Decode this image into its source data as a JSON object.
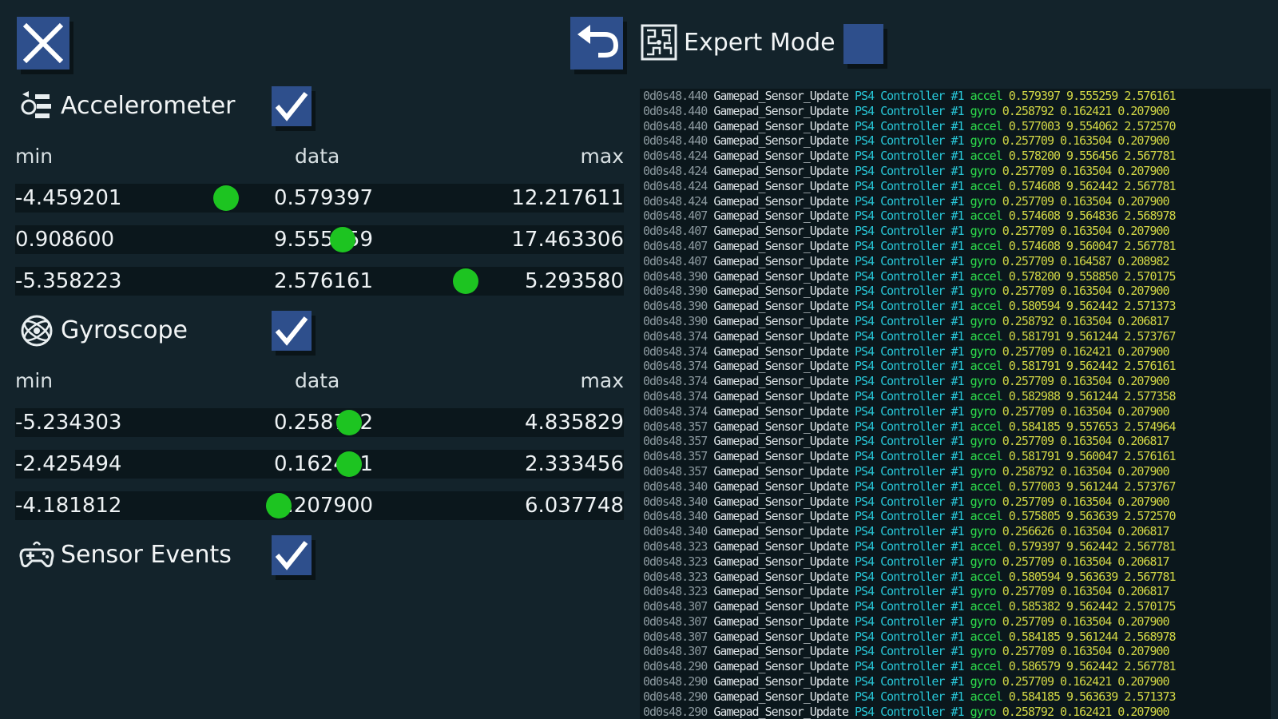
{
  "header": {
    "expert_mode_label": "Expert Mode"
  },
  "sections": {
    "accelerometer": {
      "title": "Accelerometer",
      "checked": true,
      "col_min": "min",
      "col_data": "data",
      "col_max": "max",
      "rows": [
        {
          "min": "-4.459201",
          "data": "0.579397",
          "max": "12.217611",
          "level": 0.34
        },
        {
          "min": "0.908600",
          "data": "9.555259",
          "max": "17.463306",
          "level": 0.54
        },
        {
          "min": "-5.358223",
          "data": "2.576161",
          "max": "5.293580",
          "level": 0.75
        }
      ]
    },
    "gyroscope": {
      "title": "Gyroscope",
      "checked": true,
      "col_min": "min",
      "col_data": "data",
      "col_max": "max",
      "rows": [
        {
          "min": "-5.234303",
          "data": "0.258792",
          "max": "4.835829",
          "level": 0.55
        },
        {
          "min": "-2.425494",
          "data": "0.162421",
          "max": "2.333456",
          "level": 0.55
        },
        {
          "min": "-4.181812",
          "data": "0.207900",
          "max": "6.037748",
          "level": 0.43
        }
      ]
    },
    "sensor_events": {
      "title": "Sensor Events",
      "checked": true
    }
  },
  "log": {
    "lines": [
      {
        "time": "0d0s48.440",
        "func": "Gamepad_Sensor_Update",
        "device": "PS4 Controller #1",
        "type": "accel",
        "values": "0.579397 9.555259 2.576161"
      },
      {
        "time": "0d0s48.440",
        "func": "Gamepad_Sensor_Update",
        "device": "PS4 Controller #1",
        "type": "gyro",
        "values": "0.258792 0.162421 0.207900"
      },
      {
        "time": "0d0s48.440",
        "func": "Gamepad_Sensor_Update",
        "device": "PS4 Controller #1",
        "type": "accel",
        "values": "0.577003 9.554062 2.572570"
      },
      {
        "time": "0d0s48.440",
        "func": "Gamepad_Sensor_Update",
        "device": "PS4 Controller #1",
        "type": "gyro",
        "values": "0.257709 0.163504 0.207900"
      },
      {
        "time": "0d0s48.424",
        "func": "Gamepad_Sensor_Update",
        "device": "PS4 Controller #1",
        "type": "accel",
        "values": "0.578200 9.556456 2.567781"
      },
      {
        "time": "0d0s48.424",
        "func": "Gamepad_Sensor_Update",
        "device": "PS4 Controller #1",
        "type": "gyro",
        "values": "0.257709 0.163504 0.207900"
      },
      {
        "time": "0d0s48.424",
        "func": "Gamepad_Sensor_Update",
        "device": "PS4 Controller #1",
        "type": "accel",
        "values": "0.574608 9.562442 2.567781"
      },
      {
        "time": "0d0s48.424",
        "func": "Gamepad_Sensor_Update",
        "device": "PS4 Controller #1",
        "type": "gyro",
        "values": "0.257709 0.163504 0.207900"
      },
      {
        "time": "0d0s48.407",
        "func": "Gamepad_Sensor_Update",
        "device": "PS4 Controller #1",
        "type": "accel",
        "values": "0.574608 9.564836 2.568978"
      },
      {
        "time": "0d0s48.407",
        "func": "Gamepad_Sensor_Update",
        "device": "PS4 Controller #1",
        "type": "gyro",
        "values": "0.257709 0.163504 0.207900"
      },
      {
        "time": "0d0s48.407",
        "func": "Gamepad_Sensor_Update",
        "device": "PS4 Controller #1",
        "type": "accel",
        "values": "0.574608 9.560047 2.567781"
      },
      {
        "time": "0d0s48.407",
        "func": "Gamepad_Sensor_Update",
        "device": "PS4 Controller #1",
        "type": "gyro",
        "values": "0.257709 0.164587 0.208982"
      },
      {
        "time": "0d0s48.390",
        "func": "Gamepad_Sensor_Update",
        "device": "PS4 Controller #1",
        "type": "accel",
        "values": "0.578200 9.558850 2.570175"
      },
      {
        "time": "0d0s48.390",
        "func": "Gamepad_Sensor_Update",
        "device": "PS4 Controller #1",
        "type": "gyro",
        "values": "0.257709 0.163504 0.207900"
      },
      {
        "time": "0d0s48.390",
        "func": "Gamepad_Sensor_Update",
        "device": "PS4 Controller #1",
        "type": "accel",
        "values": "0.580594 9.562442 2.571373"
      },
      {
        "time": "0d0s48.390",
        "func": "Gamepad_Sensor_Update",
        "device": "PS4 Controller #1",
        "type": "gyro",
        "values": "0.258792 0.163504 0.206817"
      },
      {
        "time": "0d0s48.374",
        "func": "Gamepad_Sensor_Update",
        "device": "PS4 Controller #1",
        "type": "accel",
        "values": "0.581791 9.561244 2.573767"
      },
      {
        "time": "0d0s48.374",
        "func": "Gamepad_Sensor_Update",
        "device": "PS4 Controller #1",
        "type": "gyro",
        "values": "0.257709 0.162421 0.207900"
      },
      {
        "time": "0d0s48.374",
        "func": "Gamepad_Sensor_Update",
        "device": "PS4 Controller #1",
        "type": "accel",
        "values": "0.581791 9.562442 2.576161"
      },
      {
        "time": "0d0s48.374",
        "func": "Gamepad_Sensor_Update",
        "device": "PS4 Controller #1",
        "type": "gyro",
        "values": "0.257709 0.163504 0.207900"
      },
      {
        "time": "0d0s48.374",
        "func": "Gamepad_Sensor_Update",
        "device": "PS4 Controller #1",
        "type": "accel",
        "values": "0.582988 9.561244 2.577358"
      },
      {
        "time": "0d0s48.374",
        "func": "Gamepad_Sensor_Update",
        "device": "PS4 Controller #1",
        "type": "gyro",
        "values": "0.257709 0.163504 0.207900"
      },
      {
        "time": "0d0s48.357",
        "func": "Gamepad_Sensor_Update",
        "device": "PS4 Controller #1",
        "type": "accel",
        "values": "0.584185 9.557653 2.574964"
      },
      {
        "time": "0d0s48.357",
        "func": "Gamepad_Sensor_Update",
        "device": "PS4 Controller #1",
        "type": "gyro",
        "values": "0.257709 0.163504 0.206817"
      },
      {
        "time": "0d0s48.357",
        "func": "Gamepad_Sensor_Update",
        "device": "PS4 Controller #1",
        "type": "accel",
        "values": "0.581791 9.560047 2.576161"
      },
      {
        "time": "0d0s48.357",
        "func": "Gamepad_Sensor_Update",
        "device": "PS4 Controller #1",
        "type": "gyro",
        "values": "0.258792 0.163504 0.207900"
      },
      {
        "time": "0d0s48.340",
        "func": "Gamepad_Sensor_Update",
        "device": "PS4 Controller #1",
        "type": "accel",
        "values": "0.577003 9.561244 2.573767"
      },
      {
        "time": "0d0s48.340",
        "func": "Gamepad_Sensor_Update",
        "device": "PS4 Controller #1",
        "type": "gyro",
        "values": "0.257709 0.163504 0.207900"
      },
      {
        "time": "0d0s48.340",
        "func": "Gamepad_Sensor_Update",
        "device": "PS4 Controller #1",
        "type": "accel",
        "values": "0.575805 9.563639 2.572570"
      },
      {
        "time": "0d0s48.340",
        "func": "Gamepad_Sensor_Update",
        "device": "PS4 Controller #1",
        "type": "gyro",
        "values": "0.256626 0.163504 0.206817"
      },
      {
        "time": "0d0s48.323",
        "func": "Gamepad_Sensor_Update",
        "device": "PS4 Controller #1",
        "type": "accel",
        "values": "0.579397 9.562442 2.567781"
      },
      {
        "time": "0d0s48.323",
        "func": "Gamepad_Sensor_Update",
        "device": "PS4 Controller #1",
        "type": "gyro",
        "values": "0.257709 0.163504 0.206817"
      },
      {
        "time": "0d0s48.323",
        "func": "Gamepad_Sensor_Update",
        "device": "PS4 Controller #1",
        "type": "accel",
        "values": "0.580594 9.563639 2.567781"
      },
      {
        "time": "0d0s48.323",
        "func": "Gamepad_Sensor_Update",
        "device": "PS4 Controller #1",
        "type": "gyro",
        "values": "0.257709 0.163504 0.206817"
      },
      {
        "time": "0d0s48.307",
        "func": "Gamepad_Sensor_Update",
        "device": "PS4 Controller #1",
        "type": "accel",
        "values": "0.585382 9.562442 2.570175"
      },
      {
        "time": "0d0s48.307",
        "func": "Gamepad_Sensor_Update",
        "device": "PS4 Controller #1",
        "type": "gyro",
        "values": "0.257709 0.163504 0.207900"
      },
      {
        "time": "0d0s48.307",
        "func": "Gamepad_Sensor_Update",
        "device": "PS4 Controller #1",
        "type": "accel",
        "values": "0.584185 9.561244 2.568978"
      },
      {
        "time": "0d0s48.307",
        "func": "Gamepad_Sensor_Update",
        "device": "PS4 Controller #1",
        "type": "gyro",
        "values": "0.257709 0.163504 0.207900"
      },
      {
        "time": "0d0s48.290",
        "func": "Gamepad_Sensor_Update",
        "device": "PS4 Controller #1",
        "type": "accel",
        "values": "0.586579 9.562442 2.567781"
      },
      {
        "time": "0d0s48.290",
        "func": "Gamepad_Sensor_Update",
        "device": "PS4 Controller #1",
        "type": "gyro",
        "values": "0.257709 0.162421 0.207900"
      },
      {
        "time": "0d0s48.290",
        "func": "Gamepad_Sensor_Update",
        "device": "PS4 Controller #1",
        "type": "accel",
        "values": "0.584185 9.563639 2.571373"
      },
      {
        "time": "0d0s48.290",
        "func": "Gamepad_Sensor_Update",
        "device": "PS4 Controller #1",
        "type": "gyro",
        "values": "0.258792 0.162421 0.207900"
      }
    ]
  },
  "icons": {
    "close": "close-icon",
    "back": "undo-arrow-icon",
    "expert": "circuit-chip-icon",
    "accelerometer": "accelerometer-icon",
    "gyroscope": "gyroscope-icon",
    "sensor_events": "gamepad-icon",
    "check": "checkmark-icon"
  },
  "colors": {
    "background": "#13232b",
    "row_background": "#0b171c",
    "button": "#2e4f8c",
    "dot": "#1dc421",
    "log_time": "#8d9aa0",
    "log_func": "#dfe5e8",
    "log_device": "#28c7d8",
    "log_type": "#2ee24c",
    "log_values": "#d3d846"
  }
}
